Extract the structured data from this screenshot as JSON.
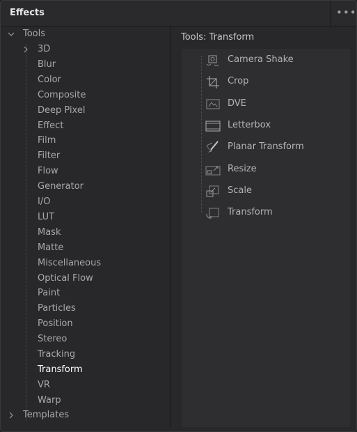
{
  "header": {
    "title": "Effects",
    "more_icon": "•••"
  },
  "tree": {
    "root": {
      "label": "Tools",
      "chevron": "⌄"
    },
    "items": [
      {
        "label": "3D",
        "chevron": "›"
      },
      {
        "label": "Blur"
      },
      {
        "label": "Color"
      },
      {
        "label": "Composite"
      },
      {
        "label": "Deep Pixel"
      },
      {
        "label": "Effect"
      },
      {
        "label": "Film"
      },
      {
        "label": "Filter"
      },
      {
        "label": "Flow"
      },
      {
        "label": "Generator"
      },
      {
        "label": "I/O"
      },
      {
        "label": "LUT"
      },
      {
        "label": "Mask"
      },
      {
        "label": "Matte"
      },
      {
        "label": "Miscellaneous"
      },
      {
        "label": "Optical Flow"
      },
      {
        "label": "Paint"
      },
      {
        "label": "Particles"
      },
      {
        "label": "Position"
      },
      {
        "label": "Stereo"
      },
      {
        "label": "Tracking"
      },
      {
        "label": "Transform",
        "selected": true
      },
      {
        "label": "VR"
      },
      {
        "label": "Warp"
      }
    ],
    "templates": {
      "label": "Templates",
      "chevron": "›"
    }
  },
  "right": {
    "path": "Tools: Transform",
    "tools": [
      {
        "label": "Camera Shake",
        "icon": "camera-shake-icon"
      },
      {
        "label": "Crop",
        "icon": "crop-icon"
      },
      {
        "label": "DVE",
        "icon": "dve-icon"
      },
      {
        "label": "Letterbox",
        "icon": "letterbox-icon"
      },
      {
        "label": "Planar Transform",
        "icon": "planar-transform-icon"
      },
      {
        "label": "Resize",
        "icon": "resize-icon"
      },
      {
        "label": "Scale",
        "icon": "scale-icon"
      },
      {
        "label": "Transform",
        "icon": "transform-icon"
      }
    ]
  }
}
